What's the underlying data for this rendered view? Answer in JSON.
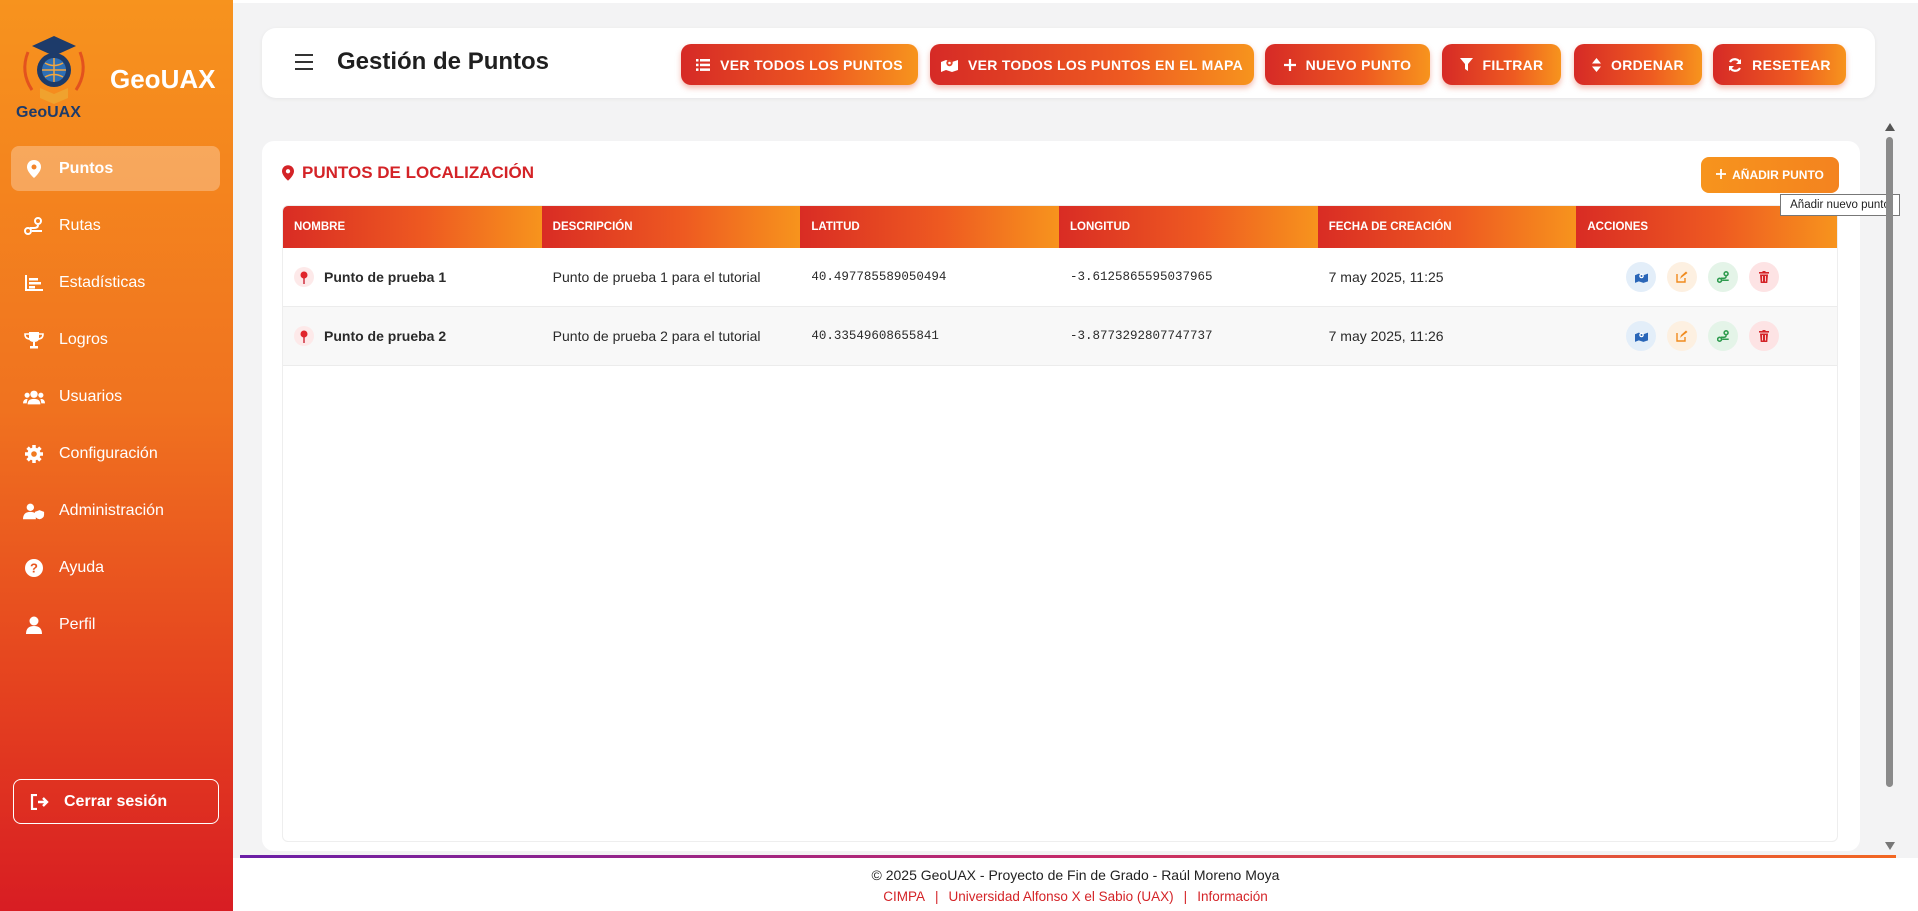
{
  "app": {
    "name": "GeoUAX",
    "logo_caption": "GeoUAX"
  },
  "sidebar": {
    "items": [
      {
        "label": "Puntos",
        "icon": "map-pin-icon",
        "active": true
      },
      {
        "label": "Rutas",
        "icon": "route-icon"
      },
      {
        "label": "Estadísticas",
        "icon": "chart-icon"
      },
      {
        "label": "Logros",
        "icon": "trophy-icon"
      },
      {
        "label": "Usuarios",
        "icon": "users-icon"
      },
      {
        "label": "Configuración",
        "icon": "gear-icon"
      },
      {
        "label": "Administración",
        "icon": "user-shield-icon"
      },
      {
        "label": "Ayuda",
        "icon": "question-icon"
      },
      {
        "label": "Perfil",
        "icon": "user-icon"
      }
    ],
    "logout_label": "Cerrar sesión"
  },
  "header": {
    "title": "Gestión de Puntos",
    "buttons": [
      {
        "label": "VER TODOS LOS PUNTOS",
        "icon": "list-icon"
      },
      {
        "label": "VER TODOS LOS PUNTOS EN EL MAPA",
        "icon": "map-icon"
      },
      {
        "label": "NUEVO PUNTO",
        "icon": "plus-icon"
      },
      {
        "label": "FILTRAR",
        "icon": "filter-icon"
      },
      {
        "label": "ORDENAR",
        "icon": "sort-icon"
      },
      {
        "label": "RESETEAR",
        "icon": "refresh-icon"
      }
    ]
  },
  "panel": {
    "title": "PUNTOS DE LOCALIZACIÓN",
    "add_button": "AÑADIR PUNTO",
    "tooltip": "Añadir nuevo punto",
    "columns": [
      "NOMBRE",
      "DESCRIPCIÓN",
      "LATITUD",
      "LONGITUD",
      "FECHA DE CREACIÓN",
      "ACCIONES"
    ],
    "rows": [
      {
        "name": "Punto de prueba 1",
        "description": "Punto de prueba 1 para el tutorial",
        "lat": "40.497785589050494",
        "lng": "-3.6125865595037965",
        "date": "7 may 2025, 11:25"
      },
      {
        "name": "Punto de prueba 2",
        "description": "Punto de prueba 2 para el tutorial",
        "lat": "40.33549608655841",
        "lng": "-3.8773292807747737",
        "date": "7 may 2025, 11:26"
      }
    ]
  },
  "footer": {
    "copyright": "© 2025 GeoUAX - Proyecto de Fin de Grado - Raúl Moreno Moya",
    "links": [
      "CIMPA",
      "Universidad Alfonso X el Sabio (UAX)",
      "Información"
    ]
  },
  "colors": {
    "accent": "#f7941d",
    "red": "#d42327"
  }
}
